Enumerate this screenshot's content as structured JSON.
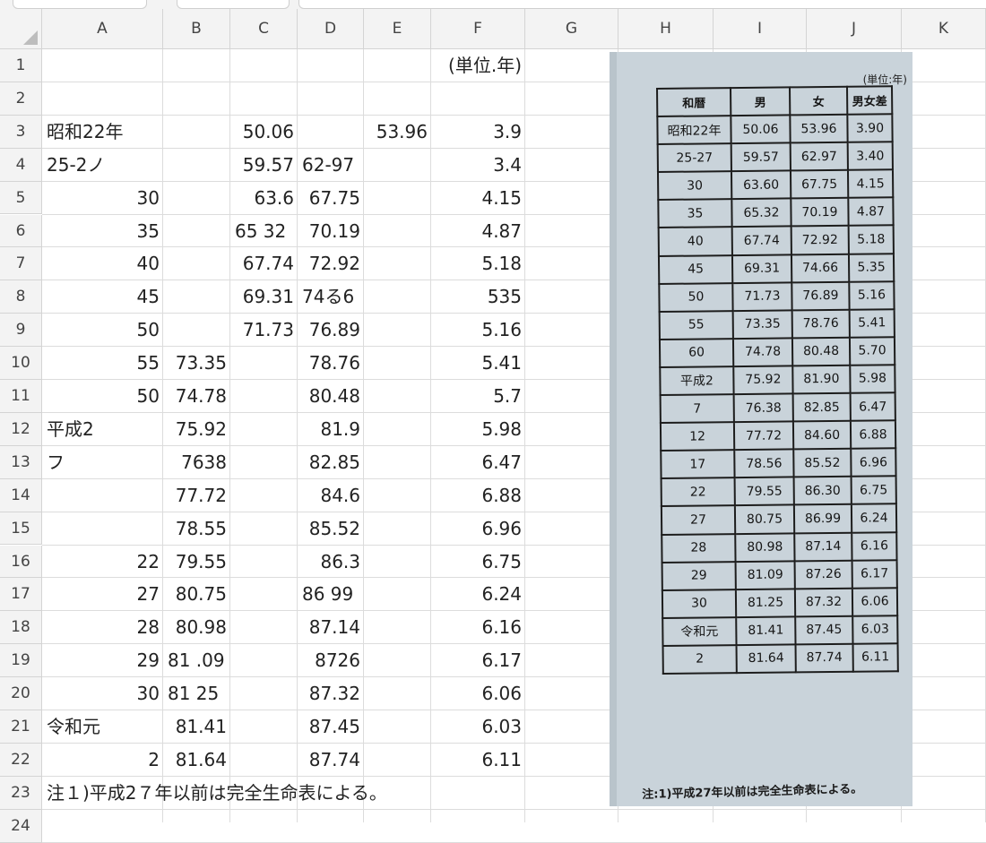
{
  "columns": [
    "A",
    "B",
    "C",
    "D",
    "E",
    "F",
    "G",
    "H",
    "I",
    "J",
    "K"
  ],
  "rows": [
    "1",
    "2",
    "3",
    "4",
    "5",
    "6",
    "7",
    "8",
    "9",
    "10",
    "11",
    "12",
    "13",
    "14",
    "15",
    "16",
    "17",
    "18",
    "19",
    "20",
    "21",
    "22",
    "23",
    "24"
  ],
  "cells": [
    {
      "ref": "F1",
      "text": "(単位.年)",
      "align": "right"
    },
    {
      "ref": "A3",
      "text": "昭和22年",
      "align": "left"
    },
    {
      "ref": "C3",
      "text": "50.06",
      "align": "right"
    },
    {
      "ref": "E3",
      "text": "53.96",
      "align": "right"
    },
    {
      "ref": "F3",
      "text": "3.9",
      "align": "right"
    },
    {
      "ref": "A4",
      "text": "25-2ノ",
      "align": "left"
    },
    {
      "ref": "C4",
      "text": "59.57",
      "align": "right"
    },
    {
      "ref": "D4",
      "text": "62-97",
      "align": "left"
    },
    {
      "ref": "F4",
      "text": "3.4",
      "align": "right"
    },
    {
      "ref": "A5",
      "text": "30",
      "align": "right"
    },
    {
      "ref": "C5",
      "text": "63.6",
      "align": "right"
    },
    {
      "ref": "D5",
      "text": "67.75",
      "align": "right"
    },
    {
      "ref": "F5",
      "text": "4.15",
      "align": "right"
    },
    {
      "ref": "A6",
      "text": "35",
      "align": "right"
    },
    {
      "ref": "C6",
      "text": "65 32",
      "align": "left"
    },
    {
      "ref": "D6",
      "text": "70.19",
      "align": "right"
    },
    {
      "ref": "F6",
      "text": "4.87",
      "align": "right"
    },
    {
      "ref": "A7",
      "text": "40",
      "align": "right"
    },
    {
      "ref": "C7",
      "text": "67.74",
      "align": "right"
    },
    {
      "ref": "D7",
      "text": "72.92",
      "align": "right"
    },
    {
      "ref": "F7",
      "text": "5.18",
      "align": "right"
    },
    {
      "ref": "A8",
      "text": "45",
      "align": "right"
    },
    {
      "ref": "C8",
      "text": "69.31",
      "align": "right"
    },
    {
      "ref": "D8",
      "text": "74る6",
      "align": "left"
    },
    {
      "ref": "F8",
      "text": "535",
      "align": "right"
    },
    {
      "ref": "A9",
      "text": "50",
      "align": "right"
    },
    {
      "ref": "C9",
      "text": "71.73",
      "align": "right"
    },
    {
      "ref": "D9",
      "text": "76.89",
      "align": "right"
    },
    {
      "ref": "F9",
      "text": "5.16",
      "align": "right"
    },
    {
      "ref": "A10",
      "text": "55",
      "align": "right"
    },
    {
      "ref": "B10",
      "text": "73.35",
      "align": "right"
    },
    {
      "ref": "D10",
      "text": "78.76",
      "align": "right"
    },
    {
      "ref": "F10",
      "text": "5.41",
      "align": "right"
    },
    {
      "ref": "A11",
      "text": "50",
      "align": "right"
    },
    {
      "ref": "B11",
      "text": "74.78",
      "align": "right"
    },
    {
      "ref": "D11",
      "text": "80.48",
      "align": "right"
    },
    {
      "ref": "F11",
      "text": "5.7",
      "align": "right"
    },
    {
      "ref": "A12",
      "text": "平成2",
      "align": "left"
    },
    {
      "ref": "B12",
      "text": "75.92",
      "align": "right"
    },
    {
      "ref": "D12",
      "text": "81.9",
      "align": "right"
    },
    {
      "ref": "F12",
      "text": "5.98",
      "align": "right"
    },
    {
      "ref": "A13",
      "text": "フ",
      "align": "left"
    },
    {
      "ref": "B13",
      "text": "7638",
      "align": "right"
    },
    {
      "ref": "D13",
      "text": "82.85",
      "align": "right"
    },
    {
      "ref": "F13",
      "text": "6.47",
      "align": "right"
    },
    {
      "ref": "B14",
      "text": "77.72",
      "align": "right"
    },
    {
      "ref": "D14",
      "text": "84.6",
      "align": "right"
    },
    {
      "ref": "F14",
      "text": "6.88",
      "align": "right"
    },
    {
      "ref": "B15",
      "text": "78.55",
      "align": "right"
    },
    {
      "ref": "D15",
      "text": "85.52",
      "align": "right"
    },
    {
      "ref": "F15",
      "text": "6.96",
      "align": "right"
    },
    {
      "ref": "A16",
      "text": "22",
      "align": "right"
    },
    {
      "ref": "B16",
      "text": "79.55",
      "align": "right"
    },
    {
      "ref": "D16",
      "text": "86.3",
      "align": "right"
    },
    {
      "ref": "F16",
      "text": "6.75",
      "align": "right"
    },
    {
      "ref": "A17",
      "text": "27",
      "align": "right"
    },
    {
      "ref": "B17",
      "text": "80.75",
      "align": "right"
    },
    {
      "ref": "D17",
      "text": "86 99",
      "align": "left"
    },
    {
      "ref": "F17",
      "text": "6.24",
      "align": "right"
    },
    {
      "ref": "A18",
      "text": "28",
      "align": "right"
    },
    {
      "ref": "B18",
      "text": "80.98",
      "align": "right"
    },
    {
      "ref": "D18",
      "text": "87.14",
      "align": "right"
    },
    {
      "ref": "F18",
      "text": "6.16",
      "align": "right"
    },
    {
      "ref": "A19",
      "text": "29",
      "align": "right"
    },
    {
      "ref": "B19",
      "text": "81 .09",
      "align": "left"
    },
    {
      "ref": "D19",
      "text": "8726",
      "align": "right"
    },
    {
      "ref": "F19",
      "text": "6.17",
      "align": "right"
    },
    {
      "ref": "A20",
      "text": "30",
      "align": "right"
    },
    {
      "ref": "B20",
      "text": "81 25",
      "align": "left"
    },
    {
      "ref": "D20",
      "text": "87.32",
      "align": "right"
    },
    {
      "ref": "F20",
      "text": "6.06",
      "align": "right"
    },
    {
      "ref": "A21",
      "text": "令和元",
      "align": "left"
    },
    {
      "ref": "B21",
      "text": "81.41",
      "align": "right"
    },
    {
      "ref": "D21",
      "text": "87.45",
      "align": "right"
    },
    {
      "ref": "F21",
      "text": "6.03",
      "align": "right"
    },
    {
      "ref": "A22",
      "text": "2",
      "align": "right"
    },
    {
      "ref": "B22",
      "text": "81.64",
      "align": "right"
    },
    {
      "ref": "D22",
      "text": "87.74",
      "align": "right"
    },
    {
      "ref": "F22",
      "text": "6.11",
      "align": "right"
    },
    {
      "ref": "A23",
      "text": "注１)平成2７年以前は完全生命表による。",
      "align": "left"
    }
  ],
  "photo": {
    "unit": "(単位:年)",
    "headers": [
      "和暦",
      "男",
      "女",
      "男女差"
    ],
    "rows": [
      [
        "昭和22年",
        "50.06",
        "53.96",
        "3.90"
      ],
      [
        "25-27",
        "59.57",
        "62.97",
        "3.40"
      ],
      [
        "30",
        "63.60",
        "67.75",
        "4.15"
      ],
      [
        "35",
        "65.32",
        "70.19",
        "4.87"
      ],
      [
        "40",
        "67.74",
        "72.92",
        "5.18"
      ],
      [
        "45",
        "69.31",
        "74.66",
        "5.35"
      ],
      [
        "50",
        "71.73",
        "76.89",
        "5.16"
      ],
      [
        "55",
        "73.35",
        "78.76",
        "5.41"
      ],
      [
        "60",
        "74.78",
        "80.48",
        "5.70"
      ],
      [
        "平成2",
        "75.92",
        "81.90",
        "5.98"
      ],
      [
        "7",
        "76.38",
        "82.85",
        "6.47"
      ],
      [
        "12",
        "77.72",
        "84.60",
        "6.88"
      ],
      [
        "17",
        "78.56",
        "85.52",
        "6.96"
      ],
      [
        "22",
        "79.55",
        "86.30",
        "6.75"
      ],
      [
        "27",
        "80.75",
        "86.99",
        "6.24"
      ],
      [
        "28",
        "80.98",
        "87.14",
        "6.16"
      ],
      [
        "29",
        "81.09",
        "87.26",
        "6.17"
      ],
      [
        "30",
        "81.25",
        "87.32",
        "6.06"
      ],
      [
        "令和元",
        "81.41",
        "87.45",
        "6.03"
      ],
      [
        "2",
        "81.64",
        "87.74",
        "6.11"
      ]
    ],
    "note": "注:1)平成27年以前は完全生命表による。"
  }
}
